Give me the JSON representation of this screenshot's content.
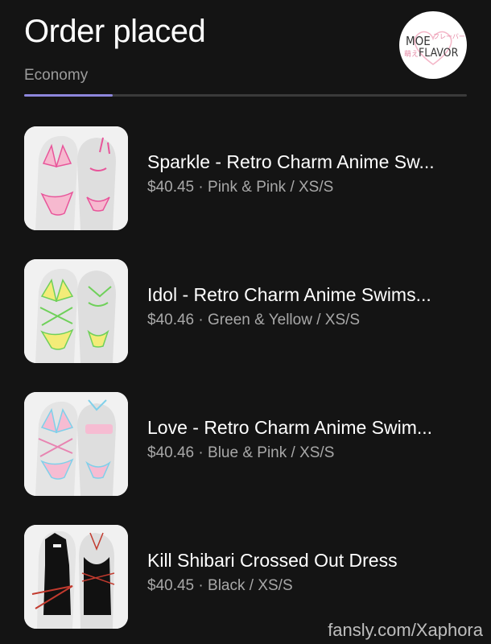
{
  "header": {
    "title": "Order placed",
    "subtitle": "Economy",
    "logo": {
      "icon": "moe-flavor-logo",
      "text_top": "MOE",
      "text_bottom": "FLAVOR",
      "text_jp": "フレーバー",
      "text_jp2": "萌え"
    }
  },
  "progress": {
    "fraction": 0.2,
    "color": "#8d86dc"
  },
  "items": [
    {
      "name": "Sparkle - Retro Charm Anime Sw...",
      "price": "$40.45",
      "variant": "Pink & Pink / XS/S",
      "icon": "pink-swimsuit-image"
    },
    {
      "name": "Idol - Retro Charm Anime Swims...",
      "price": "$40.46",
      "variant": "Green & Yellow / XS/S",
      "icon": "green-yellow-swimsuit-image"
    },
    {
      "name": "Love - Retro Charm Anime Swim...",
      "price": "$40.46",
      "variant": "Blue & Pink / XS/S",
      "icon": "blue-pink-swimsuit-image"
    },
    {
      "name": "Kill Shibari Crossed Out Dress",
      "price": "$40.45",
      "variant": "Black / XS/S",
      "icon": "black-dress-image"
    }
  ],
  "meta_separator": " · ",
  "watermark": "fansly.com/Xaphora",
  "colors": {
    "background": "#141414",
    "accent": "#8d86dc",
    "muted": "#9c9c9c"
  }
}
